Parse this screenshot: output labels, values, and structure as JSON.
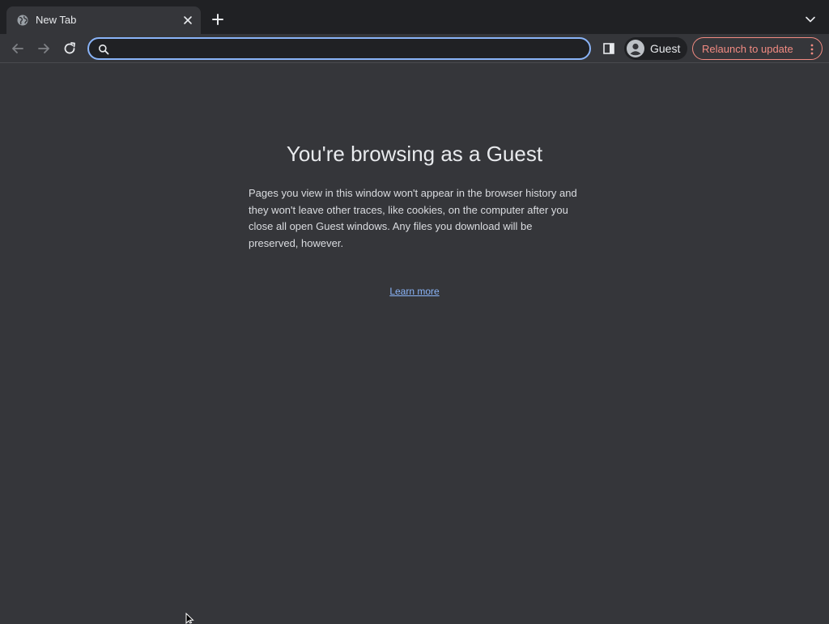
{
  "tab": {
    "title": "New Tab",
    "favicon": "globe-icon",
    "close_icon": "close-icon"
  },
  "tabstrip": {
    "new_tab_icon": "plus-icon",
    "tab_search_icon": "chevron-down-icon"
  },
  "toolbar": {
    "back_icon": "arrow-left-icon",
    "forward_icon": "arrow-right-icon",
    "reload_icon": "reload-icon",
    "side_panel_icon": "side-panel-icon",
    "relaunch_label": "Relaunch to update",
    "relaunch_menu_icon": "vertical-dots-icon"
  },
  "omnibox": {
    "value": "",
    "placeholder": "",
    "icon": "search-icon"
  },
  "profile": {
    "name": "Guest",
    "avatar_icon": "avatar-icon"
  },
  "guest_page": {
    "heading": "You're browsing as a Guest",
    "description": "Pages you view in this window won't appear in the browser history and they won't leave other traces, like cookies, on the computer after you close all open Guest windows. Any files you download will be preserved, however.",
    "learn_more": "Learn more"
  },
  "colors": {
    "tabstrip_bg": "#202124",
    "toolbar_bg": "#35363a",
    "page_bg": "#35363a",
    "omnibox_focus": "#8ab4f8",
    "relaunch_accent": "#f28b82",
    "link": "#8ab4f8"
  }
}
